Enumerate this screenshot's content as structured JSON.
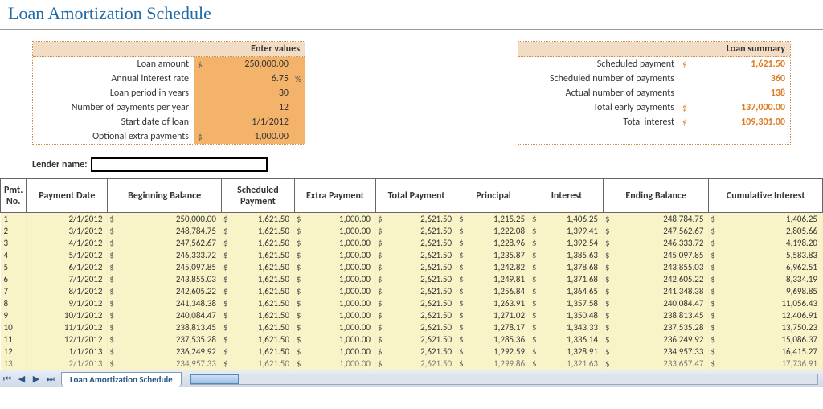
{
  "title": "Loan Amortization Schedule",
  "inputs": {
    "header": "Enter values",
    "rows": [
      {
        "label": "Loan amount",
        "sym_l": "$",
        "value": "250,000.00",
        "sym_r": ""
      },
      {
        "label": "Annual interest rate",
        "sym_l": "",
        "value": "6.75",
        "sym_r": "%"
      },
      {
        "label": "Loan period in years",
        "sym_l": "",
        "value": "30",
        "sym_r": ""
      },
      {
        "label": "Number of payments per year",
        "sym_l": "",
        "value": "12",
        "sym_r": ""
      },
      {
        "label": "Start date of loan",
        "sym_l": "",
        "value": "1/1/2012",
        "sym_r": ""
      },
      {
        "label": "Optional extra payments",
        "sym_l": "$",
        "value": "1,000.00",
        "sym_r": ""
      }
    ]
  },
  "summary": {
    "header": "Loan summary",
    "rows": [
      {
        "label": "Scheduled payment",
        "sym_l": "$",
        "value": "1,621.50"
      },
      {
        "label": "Scheduled number of payments",
        "sym_l": "",
        "value": "360"
      },
      {
        "label": "Actual number of payments",
        "sym_l": "",
        "value": "138"
      },
      {
        "label": "Total early payments",
        "sym_l": "$",
        "value": "137,000.00"
      },
      {
        "label": "Total interest",
        "sym_l": "$",
        "value": "109,301.00"
      }
    ]
  },
  "lender": {
    "label": "Lender name:",
    "value": ""
  },
  "sched_headers": [
    "Pmt. No.",
    "Payment Date",
    "Beginning Balance",
    "Scheduled Payment",
    "Extra Payment",
    "Total Payment",
    "Principal",
    "Interest",
    "Ending Balance",
    "Cumulative Interest"
  ],
  "sched_rows": [
    {
      "no": "1",
      "date": "2/1/2012",
      "beg": "250,000.00",
      "sp": "1,621.50",
      "ep": "1,000.00",
      "tp": "2,621.50",
      "pr": "1,215.25",
      "int": "1,406.25",
      "end": "248,784.75",
      "cum": "1,406.25"
    },
    {
      "no": "2",
      "date": "3/1/2012",
      "beg": "248,784.75",
      "sp": "1,621.50",
      "ep": "1,000.00",
      "tp": "2,621.50",
      "pr": "1,222.08",
      "int": "1,399.41",
      "end": "247,562.67",
      "cum": "2,805.66"
    },
    {
      "no": "3",
      "date": "4/1/2012",
      "beg": "247,562.67",
      "sp": "1,621.50",
      "ep": "1,000.00",
      "tp": "2,621.50",
      "pr": "1,228.96",
      "int": "1,392.54",
      "end": "246,333.72",
      "cum": "4,198.20"
    },
    {
      "no": "4",
      "date": "5/1/2012",
      "beg": "246,333.72",
      "sp": "1,621.50",
      "ep": "1,000.00",
      "tp": "2,621.50",
      "pr": "1,235.87",
      "int": "1,385.63",
      "end": "245,097.85",
      "cum": "5,583.83"
    },
    {
      "no": "5",
      "date": "6/1/2012",
      "beg": "245,097.85",
      "sp": "1,621.50",
      "ep": "1,000.00",
      "tp": "2,621.50",
      "pr": "1,242.82",
      "int": "1,378.68",
      "end": "243,855.03",
      "cum": "6,962.51"
    },
    {
      "no": "6",
      "date": "7/1/2012",
      "beg": "243,855.03",
      "sp": "1,621.50",
      "ep": "1,000.00",
      "tp": "2,621.50",
      "pr": "1,249.81",
      "int": "1,371.68",
      "end": "242,605.22",
      "cum": "8,334.19"
    },
    {
      "no": "7",
      "date": "8/1/2012",
      "beg": "242,605.22",
      "sp": "1,621.50",
      "ep": "1,000.00",
      "tp": "2,621.50",
      "pr": "1,256.84",
      "int": "1,364.65",
      "end": "241,348.38",
      "cum": "9,698.85"
    },
    {
      "no": "8",
      "date": "9/1/2012",
      "beg": "241,348.38",
      "sp": "1,621.50",
      "ep": "1,000.00",
      "tp": "2,621.50",
      "pr": "1,263.91",
      "int": "1,357.58",
      "end": "240,084.47",
      "cum": "11,056.43"
    },
    {
      "no": "9",
      "date": "10/1/2012",
      "beg": "240,084.47",
      "sp": "1,621.50",
      "ep": "1,000.00",
      "tp": "2,621.50",
      "pr": "1,271.02",
      "int": "1,350.48",
      "end": "238,813.45",
      "cum": "12,406.91"
    },
    {
      "no": "10",
      "date": "11/1/2012",
      "beg": "238,813.45",
      "sp": "1,621.50",
      "ep": "1,000.00",
      "tp": "2,621.50",
      "pr": "1,278.17",
      "int": "1,343.33",
      "end": "237,535.28",
      "cum": "13,750.23"
    },
    {
      "no": "11",
      "date": "12/1/2012",
      "beg": "237,535.28",
      "sp": "1,621.50",
      "ep": "1,000.00",
      "tp": "2,621.50",
      "pr": "1,285.36",
      "int": "1,336.14",
      "end": "236,249.92",
      "cum": "15,086.37"
    },
    {
      "no": "12",
      "date": "1/1/2013",
      "beg": "236,249.92",
      "sp": "1,621.50",
      "ep": "1,000.00",
      "tp": "2,621.50",
      "pr": "1,292.59",
      "int": "1,328.91",
      "end": "234,957.33",
      "cum": "16,415.27"
    },
    {
      "no": "13",
      "date": "2/1/2013",
      "beg": "234,957.33",
      "sp": "1,621.50",
      "ep": "1,000.00",
      "tp": "2,621.50",
      "pr": "1,299.86",
      "int": "1,321.63",
      "end": "233,657.47",
      "cum": "17,736.91"
    }
  ],
  "tab": "Loan Amortization Schedule",
  "chart_data": {
    "type": "table",
    "title": "Loan Amortization Schedule",
    "columns": [
      "Pmt. No.",
      "Payment Date",
      "Beginning Balance",
      "Scheduled Payment",
      "Extra Payment",
      "Total Payment",
      "Principal",
      "Interest",
      "Ending Balance",
      "Cumulative Interest"
    ],
    "rows": [
      [
        1,
        "2/1/2012",
        250000.0,
        1621.5,
        1000.0,
        2621.5,
        1215.25,
        1406.25,
        248784.75,
        1406.25
      ],
      [
        2,
        "3/1/2012",
        248784.75,
        1621.5,
        1000.0,
        2621.5,
        1222.08,
        1399.41,
        247562.67,
        2805.66
      ],
      [
        3,
        "4/1/2012",
        247562.67,
        1621.5,
        1000.0,
        2621.5,
        1228.96,
        1392.54,
        246333.72,
        4198.2
      ],
      [
        4,
        "5/1/2012",
        246333.72,
        1621.5,
        1000.0,
        2621.5,
        1235.87,
        1385.63,
        245097.85,
        5583.83
      ],
      [
        5,
        "6/1/2012",
        245097.85,
        1621.5,
        1000.0,
        2621.5,
        1242.82,
        1378.68,
        243855.03,
        6962.51
      ],
      [
        6,
        "7/1/2012",
        243855.03,
        1621.5,
        1000.0,
        2621.5,
        1249.81,
        1371.68,
        242605.22,
        8334.19
      ],
      [
        7,
        "8/1/2012",
        242605.22,
        1621.5,
        1000.0,
        2621.5,
        1256.84,
        1364.65,
        241348.38,
        9698.85
      ],
      [
        8,
        "9/1/2012",
        241348.38,
        1621.5,
        1000.0,
        2621.5,
        1263.91,
        1357.58,
        240084.47,
        11056.43
      ],
      [
        9,
        "10/1/2012",
        240084.47,
        1621.5,
        1000.0,
        2621.5,
        1271.02,
        1350.48,
        238813.45,
        12406.91
      ],
      [
        10,
        "11/1/2012",
        238813.45,
        1621.5,
        1000.0,
        2621.5,
        1278.17,
        1343.33,
        237535.28,
        13750.23
      ],
      [
        11,
        "12/1/2012",
        237535.28,
        1621.5,
        1000.0,
        2621.5,
        1285.36,
        1336.14,
        236249.92,
        15086.37
      ],
      [
        12,
        "1/1/2013",
        236249.92,
        1621.5,
        1000.0,
        2621.5,
        1292.59,
        1328.91,
        234957.33,
        16415.27
      ],
      [
        13,
        "2/1/2013",
        234957.33,
        1621.5,
        1000.0,
        2621.5,
        1299.86,
        1321.63,
        233657.47,
        17736.91
      ]
    ]
  }
}
